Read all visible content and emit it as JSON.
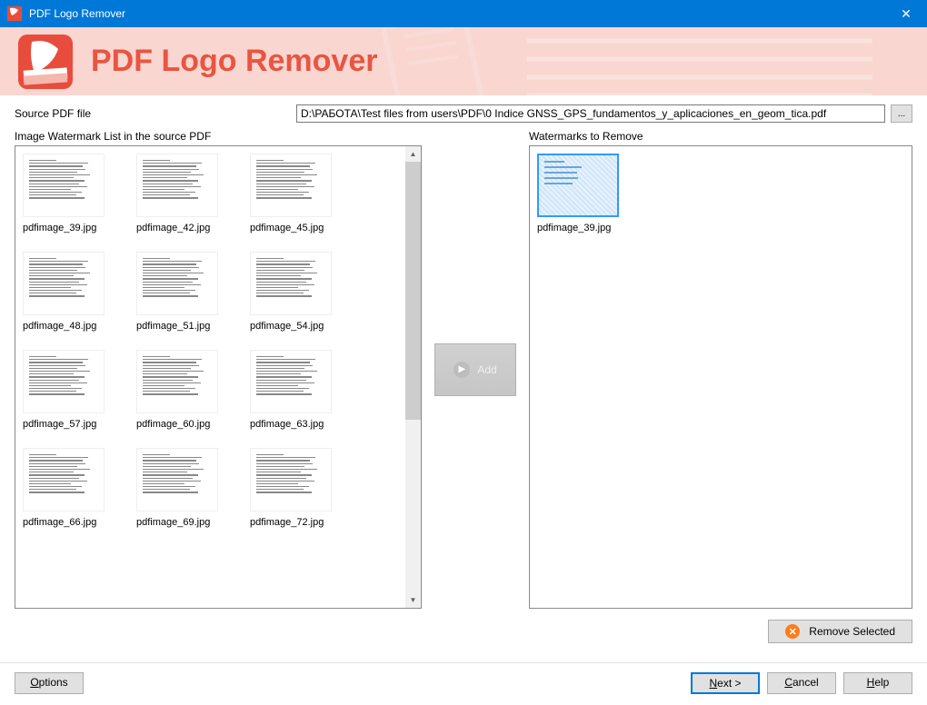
{
  "window": {
    "title": "PDF Logo Remover",
    "close_glyph": "✕"
  },
  "header": {
    "app_title": "PDF Logo Remover"
  },
  "source": {
    "label": "Source PDF file",
    "path": "D:\\РАБОТА\\Test files from users\\PDF\\0 Indice GNSS_GPS_fundamentos_y_aplicaciones_en_geom_tica.pdf",
    "browse_label": "..."
  },
  "left_panel": {
    "label": "Image Watermark List in the source PDF",
    "items": [
      {
        "caption": "pdfimage_39.jpg"
      },
      {
        "caption": "pdfimage_42.jpg"
      },
      {
        "caption": "pdfimage_45.jpg"
      },
      {
        "caption": "pdfimage_48.jpg"
      },
      {
        "caption": "pdfimage_51.jpg"
      },
      {
        "caption": "pdfimage_54.jpg"
      },
      {
        "caption": "pdfimage_57.jpg"
      },
      {
        "caption": "pdfimage_60.jpg"
      },
      {
        "caption": "pdfimage_63.jpg"
      },
      {
        "caption": "pdfimage_66.jpg"
      },
      {
        "caption": "pdfimage_69.jpg"
      },
      {
        "caption": "pdfimage_72.jpg"
      }
    ]
  },
  "add_button": {
    "label": "Add"
  },
  "right_panel": {
    "label": "Watermarks to Remove",
    "items": [
      {
        "caption": "pdfimage_39.jpg"
      }
    ]
  },
  "remove_button": {
    "label": "Remove Selected"
  },
  "footer": {
    "options": "Options",
    "next": "Next >",
    "cancel": "Cancel",
    "help": "Help"
  }
}
